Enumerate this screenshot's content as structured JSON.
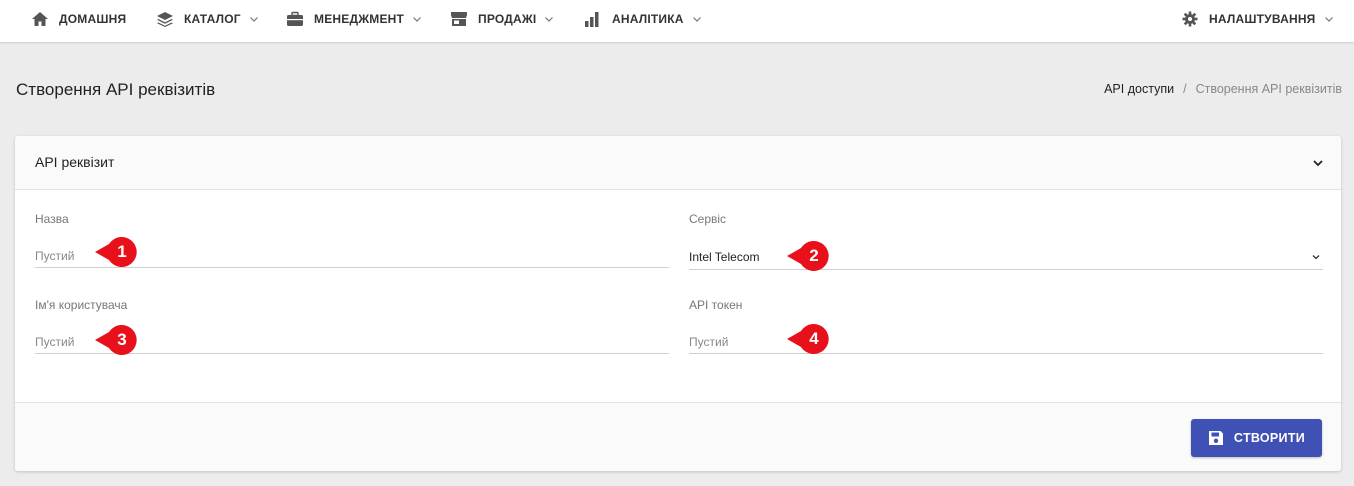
{
  "nav": {
    "home": {
      "label": "ДОМАШНЯ",
      "icon": "home-icon"
    },
    "catalog": {
      "label": "КАТАЛОГ",
      "icon": "layers-icon"
    },
    "management": {
      "label": "МЕНЕДЖМЕНТ",
      "icon": "briefcase-icon"
    },
    "sales": {
      "label": "ПРОДАЖІ",
      "icon": "store-icon"
    },
    "analytics": {
      "label": "АНАЛІТИКА",
      "icon": "bar-chart-icon"
    },
    "settings": {
      "label": "НАЛАШТУВАННЯ",
      "icon": "gear-icon"
    }
  },
  "page": {
    "title": "Створення API реквізитів",
    "breadcrumb": {
      "link": "API доступи",
      "separator": "/",
      "current": "Створення API реквізитів"
    }
  },
  "card": {
    "title": "API реквізит",
    "fields": {
      "name": {
        "label": "Назва",
        "placeholder": "Пустий",
        "marker": "1"
      },
      "service": {
        "label": "Сервіс",
        "value": "Intel Telecom",
        "marker": "2"
      },
      "username": {
        "label": "Ім'я користувача",
        "placeholder": "Пустий",
        "marker": "3"
      },
      "token": {
        "label": "API токен",
        "placeholder": "Пустий",
        "marker": "4"
      }
    },
    "create_label": "СТВОРИТИ"
  },
  "colors": {
    "accent": "#3f51b5",
    "marker": "#e8101a",
    "background": "#ececec"
  }
}
